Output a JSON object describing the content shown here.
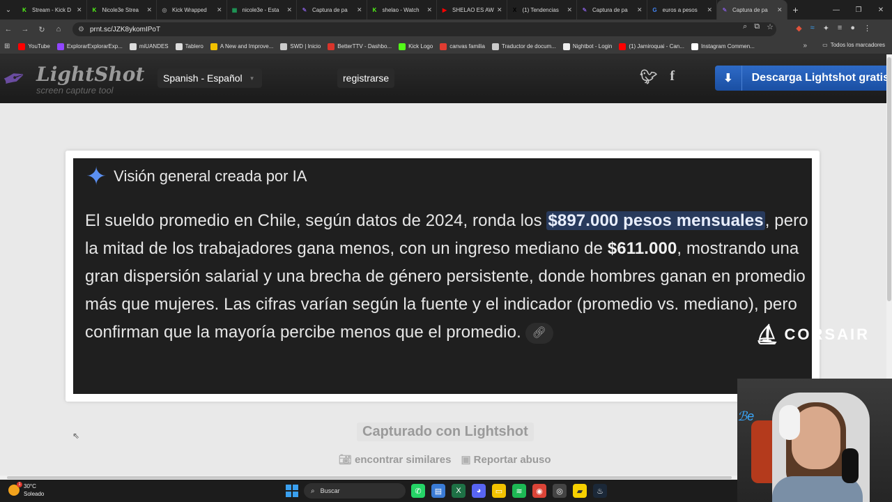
{
  "browser": {
    "tabs": [
      {
        "label": "Stream - Kick D",
        "fav_color": "#53fc18",
        "fav_glyph": "K"
      },
      {
        "label": "Nicole3e Strea",
        "fav_color": "#53fc18",
        "fav_glyph": "K"
      },
      {
        "label": "Kick Wrapped",
        "fav_color": "#888888",
        "fav_glyph": "◎"
      },
      {
        "label": "nicole3e - Esta",
        "fav_color": "#1e9e5a",
        "fav_glyph": "▦"
      },
      {
        "label": "Captura de pa",
        "fav_color": "#7a56c4",
        "fav_glyph": "✎"
      },
      {
        "label": "shelao - Watch",
        "fav_color": "#53fc18",
        "fav_glyph": "K"
      },
      {
        "label": "SHELAO ES AW",
        "fav_color": "#ff0000",
        "fav_glyph": "▶"
      },
      {
        "label": "(1) Tendencias",
        "fav_color": "#000000",
        "fav_glyph": "X"
      },
      {
        "label": "Captura de pa",
        "fav_color": "#7a56c4",
        "fav_glyph": "✎"
      },
      {
        "label": "euros a pesos",
        "fav_color": "#4285f4",
        "fav_glyph": "G"
      },
      {
        "label": "Captura de pa",
        "fav_color": "#7a56c4",
        "fav_glyph": "✎"
      }
    ],
    "active_tab_index": 10,
    "url": "prnt.sc/JZK8ykomIPoT",
    "bookmarks": [
      {
        "label": "YouTube",
        "color": "#ff0000"
      },
      {
        "label": "ExplorarExplorarExp...",
        "color": "#9146ff"
      },
      {
        "label": "miUANDES",
        "color": "#dddddd"
      },
      {
        "label": "Tablero",
        "color": "#dddddd"
      },
      {
        "label": "A New and Improve...",
        "color": "#f2c200"
      },
      {
        "label": "SWD | Inicio",
        "color": "#cccccc"
      },
      {
        "label": "BetterTTV - Dashbo...",
        "color": "#d9342b"
      },
      {
        "label": "Kick Logo",
        "color": "#53fc18"
      },
      {
        "label": "canvas familia",
        "color": "#e03c31"
      },
      {
        "label": "Traductor de docum...",
        "color": "#cccccc"
      },
      {
        "label": "Nightbot - Login",
        "color": "#eeeeee"
      },
      {
        "label": "(1) Jamiroquai - Can...",
        "color": "#ff0000"
      },
      {
        "label": "Instagram Commen...",
        "color": "#ffffff"
      }
    ],
    "all_bookmarks_label": "Todos los marcadores"
  },
  "lightshot": {
    "logo_text": "LightShot",
    "logo_sub": "screen capture tool",
    "language": "Spanish - Español",
    "register": "registrarse",
    "download": "Descarga Lightshot gratis",
    "captured_with": "Capturado con Lightshot",
    "find_similar": "encontrar similares",
    "report_abuse": "Reportar abuso"
  },
  "screenshot": {
    "heading": "Visión general creada por IA",
    "text_1": "El sueldo promedio en Chile, según datos de 2024, ronda los ",
    "highlight": "$897.000 pesos mensuales",
    "text_2": ", pero la mitad de los trabajadores gana menos, con un ingreso mediano de ",
    "bold_2": "$611.000",
    "text_3": ", mostrando una gran dispersión salarial y una brecha de género persistente, donde hombres ganan en promedio más que mujeres. Las cifras varían según la fuente y el indicador (promedio vs. mediano), pero confirman que la mayoría percibe menos que el promedio.",
    "watermark": "CORSAIR",
    "accent": "#5b8ff0"
  },
  "taskbar": {
    "temperature": "30°C",
    "weather": "Soleado",
    "weather_badge": "1",
    "search_placeholder": "Buscar"
  }
}
